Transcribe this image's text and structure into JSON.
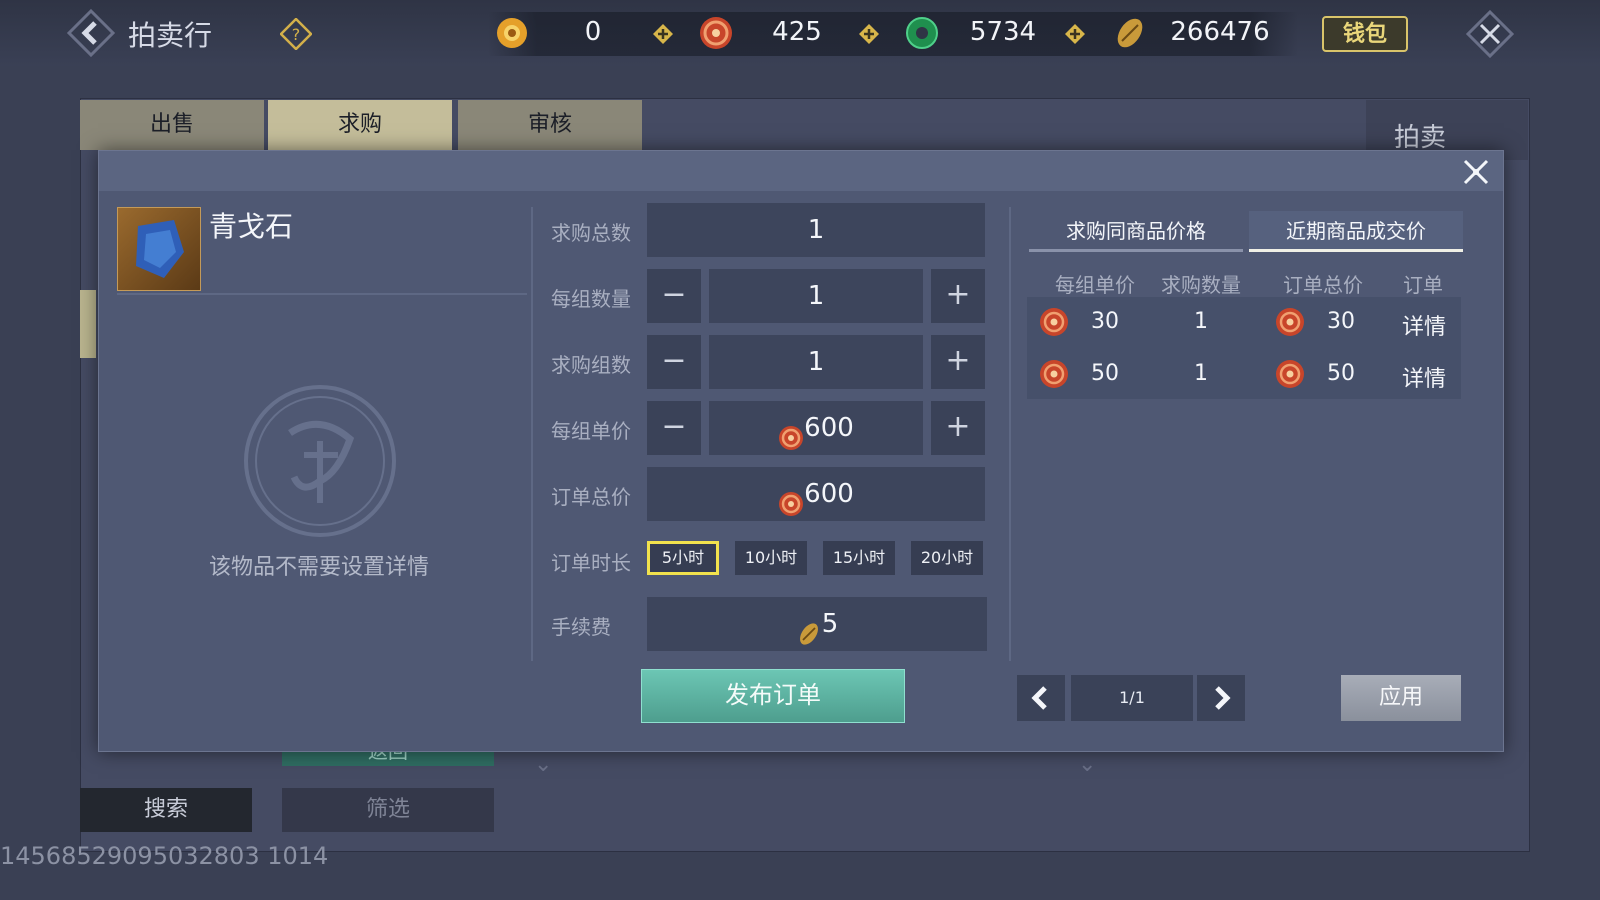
{
  "header": {
    "title": "拍卖行",
    "currencies": [
      {
        "icon": "gold-ingot-icon",
        "value": "0"
      },
      {
        "icon": "red-swirl-coin-icon",
        "value": "425"
      },
      {
        "icon": "jade-ring-icon",
        "value": "5734"
      },
      {
        "icon": "shell-coin-icon",
        "value": "266476"
      }
    ],
    "wallet_label": "钱包"
  },
  "background_window": {
    "tabs": [
      "出售",
      "求购",
      "审核"
    ],
    "active_tab": "求购",
    "side_title": "拍卖",
    "search_label": "搜索",
    "filter_label": "筛选",
    "serial": "14568529095032803 1014",
    "hidden_button_text": "返回"
  },
  "dialog": {
    "item": {
      "name": "青戈石",
      "no_detail_text": "该物品不需要设置详情"
    },
    "form": {
      "total_label": "求购总数",
      "total_value": "1",
      "per_group_label": "每组数量",
      "per_group_value": "1",
      "groups_label": "求购组数",
      "groups_value": "1",
      "unit_price_label": "每组单价",
      "unit_price_value": "600",
      "order_total_label": "订单总价",
      "order_total_value": "600",
      "duration_label": "订单时长",
      "durations": [
        "5小时",
        "10小时",
        "15小时",
        "20小时"
      ],
      "selected_duration": "5小时",
      "fee_label": "手续费",
      "fee_value": "5",
      "minus": "−",
      "plus": "+",
      "publish_label": "发布订单"
    },
    "market": {
      "tabs": [
        "求购同商品价格",
        "近期商品成交价"
      ],
      "active_tab": "近期商品成交价",
      "columns": [
        "每组单价",
        "求购数量",
        "订单总价",
        "订单"
      ],
      "rows": [
        {
          "unit_price": "30",
          "quantity": "1",
          "total": "30",
          "action": "详情"
        },
        {
          "unit_price": "50",
          "quantity": "1",
          "total": "50",
          "action": "详情"
        }
      ],
      "page": "1/1",
      "apply_label": "应用"
    }
  },
  "colors": {
    "selected_border": "#f2e24d",
    "publish_button": "#5fb6a4",
    "active_tab_underline": "#f0f0e6"
  }
}
